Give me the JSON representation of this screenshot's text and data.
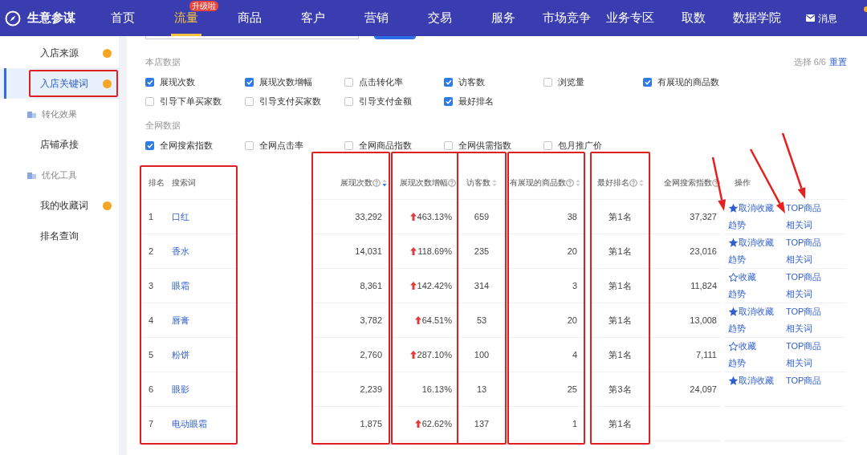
{
  "nav": {
    "logo": "生意参谋",
    "items": [
      {
        "label": "首页",
        "selected": false
      },
      {
        "label": "流量",
        "selected": true,
        "badge": "升级啦"
      },
      {
        "label": "商品",
        "selected": false
      },
      {
        "label": "客户",
        "selected": false
      },
      {
        "label": "营销",
        "selected": false
      },
      {
        "label": "交易",
        "selected": false
      },
      {
        "label": "服务",
        "selected": false
      },
      {
        "label": "市场竞争",
        "selected": false
      },
      {
        "label": "业务专区",
        "selected": false
      },
      {
        "label": "取数",
        "selected": false
      },
      {
        "label": "数据学院",
        "selected": false
      }
    ],
    "messages": {
      "label": "消息",
      "unread": true
    }
  },
  "sidebar": {
    "items": [
      {
        "kind": "link",
        "label": "入店来源",
        "dot": true,
        "selected": false,
        "highlighted": false
      },
      {
        "kind": "link",
        "label": "入店关键词",
        "dot": true,
        "selected": true,
        "highlighted": true
      },
      {
        "kind": "section",
        "label": "转化效果"
      },
      {
        "kind": "link",
        "label": "店铺承接",
        "dot": false,
        "selected": false,
        "highlighted": false
      },
      {
        "kind": "section",
        "label": "优化工具"
      },
      {
        "kind": "link",
        "label": "我的收藏词",
        "dot": true,
        "selected": false,
        "highlighted": false
      },
      {
        "kind": "link",
        "label": "排名查询",
        "dot": false,
        "selected": false,
        "highlighted": false
      }
    ]
  },
  "metrics": {
    "selection": "选择 6/6",
    "reset": "重置",
    "groups": [
      {
        "title": "本店数据",
        "options": [
          {
            "label": "展现次数",
            "checked": true
          },
          {
            "label": "展现次数增幅",
            "checked": true
          },
          {
            "label": "点击转化率",
            "checked": false
          },
          {
            "label": "访客数",
            "checked": true
          },
          {
            "label": "浏览量",
            "checked": false
          },
          {
            "label": "有展现的商品数",
            "checked": true
          },
          {
            "label": "引导下单买家数",
            "checked": false
          },
          {
            "label": "引导支付买家数",
            "checked": false
          },
          {
            "label": "引导支付金额",
            "checked": false
          },
          {
            "label": "最好排名",
            "checked": true
          }
        ]
      },
      {
        "title": "全网数据",
        "options": [
          {
            "label": "全网搜索指数",
            "checked": true
          },
          {
            "label": "全网点击率",
            "checked": false
          },
          {
            "label": "全网商品指数",
            "checked": false
          },
          {
            "label": "全网供需指数",
            "checked": false
          },
          {
            "label": "包月推广价",
            "checked": false
          }
        ]
      }
    ]
  },
  "table": {
    "column_groups": [
      {
        "highlighted": true,
        "columns": [
          {
            "label": "排名",
            "kind": "text",
            "help": false,
            "sortable": false
          },
          {
            "label": "搜索词",
            "kind": "keyword",
            "help": false,
            "sortable": false
          }
        ]
      },
      {
        "highlighted": true,
        "columns": [
          {
            "label": "展现次数",
            "kind": "text",
            "help": true,
            "sortable": true,
            "sorted": true
          }
        ]
      },
      {
        "highlighted": true,
        "columns": [
          {
            "label": "展现次数增幅",
            "kind": "growth",
            "help": true,
            "sortable": false
          }
        ]
      },
      {
        "highlighted": true,
        "columns": [
          {
            "label": "访客数",
            "kind": "text",
            "help": false,
            "sortable": true,
            "sorted": false
          }
        ]
      },
      {
        "highlighted": true,
        "columns": [
          {
            "label": "有展现的商品数",
            "kind": "text",
            "help": true,
            "sortable": true,
            "sorted": false
          }
        ]
      },
      {
        "highlighted": true,
        "columns": [
          {
            "label": "最好排名",
            "kind": "text",
            "help": true,
            "sortable": true,
            "sorted": false
          }
        ]
      },
      {
        "highlighted": false,
        "columns": [
          {
            "label": "全网搜索指数",
            "kind": "text",
            "help": true,
            "sortable": false
          }
        ]
      },
      {
        "highlighted": false,
        "columns": [
          {
            "label": "操作",
            "kind": "actions",
            "help": false,
            "sortable": false
          }
        ]
      }
    ],
    "rows": [
      {
        "cells": [
          "1",
          "口红",
          "33,292",
          {
            "value": "463.13%",
            "up": true
          },
          "659",
          "38",
          "第1名",
          "37,327",
          {
            "favorited": true,
            "favorite": "取消收藏",
            "trend": "趋势",
            "top": "TOP商品",
            "related": "相关词"
          }
        ]
      },
      {
        "cells": [
          "2",
          "香水",
          "14,031",
          {
            "value": "118.69%",
            "up": true
          },
          "235",
          "20",
          "第1名",
          "23,016",
          {
            "favorited": true,
            "favorite": "取消收藏",
            "trend": "趋势",
            "top": "TOP商品",
            "related": "相关词"
          }
        ]
      },
      {
        "cells": [
          "3",
          "眼霜",
          "8,361",
          {
            "value": "142.42%",
            "up": true
          },
          "314",
          "3",
          "第1名",
          "11,824",
          {
            "favorited": false,
            "favorite": "收藏",
            "trend": "趋势",
            "top": "TOP商品",
            "related": "相关词"
          }
        ]
      },
      {
        "cells": [
          "4",
          "唇膏",
          "3,782",
          {
            "value": "64.51%",
            "up": true
          },
          "53",
          "20",
          "第1名",
          "13,008",
          {
            "favorited": true,
            "favorite": "取消收藏",
            "trend": "趋势",
            "top": "TOP商品",
            "related": "相关词"
          }
        ]
      },
      {
        "cells": [
          "5",
          "粉饼",
          "2,760",
          {
            "value": "287.10%",
            "up": true
          },
          "100",
          "4",
          "第1名",
          "7,111",
          {
            "favorited": false,
            "favorite": "收藏",
            "trend": "趋势",
            "top": "TOP商品",
            "related": "相关词"
          }
        ]
      },
      {
        "cells": [
          "6",
          "眼影",
          "2,239",
          {
            "value": "16.13%",
            "up": false
          },
          "13",
          "25",
          "第3名",
          "24,097",
          {
            "favorited": true,
            "favorite": "取消收藏",
            "top": "TOP商品"
          }
        ]
      },
      {
        "cells": [
          "7",
          "电动眼霜",
          "1,875",
          {
            "value": "62.62%",
            "up": true
          },
          "137",
          "1",
          "第1名"
        ]
      }
    ]
  },
  "annotation_arrows": [
    {
      "kind": "trend"
    },
    {
      "kind": "related"
    },
    {
      "kind": "top"
    }
  ]
}
